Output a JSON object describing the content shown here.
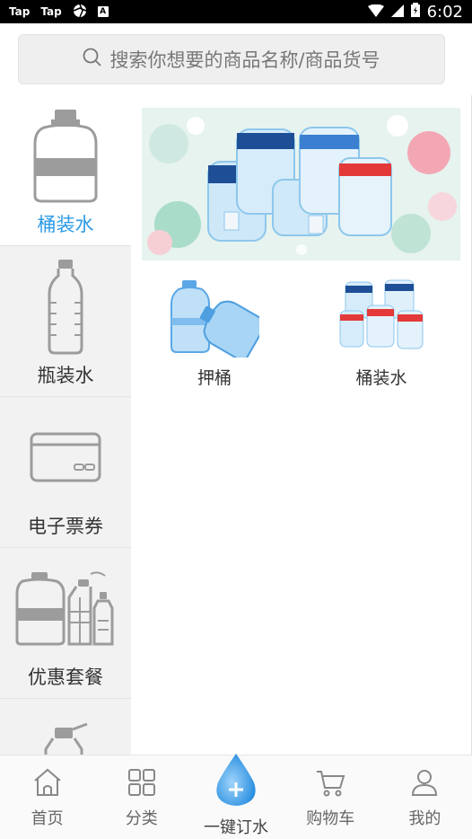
{
  "status_bar": {
    "left_labels": [
      "Tap",
      "Tap"
    ],
    "time": "6:02"
  },
  "search": {
    "placeholder": "搜索你想要的商品名称/商品货号"
  },
  "sidebar": {
    "items": [
      {
        "label": "桶装水",
        "icon": "water-bucket-icon",
        "active": true
      },
      {
        "label": "瓶装水",
        "icon": "water-bottle-icon",
        "active": false
      },
      {
        "label": "电子票券",
        "icon": "ticket-card-icon",
        "active": false
      },
      {
        "label": "优惠套餐",
        "icon": "combo-package-icon",
        "active": false
      },
      {
        "label": "",
        "icon": "spray-bottle-icon",
        "active": false
      }
    ]
  },
  "content": {
    "categories": [
      {
        "name": "押桶",
        "icon": "deposit-bucket-image"
      },
      {
        "name": "桶装水",
        "icon": "bucket-water-image"
      }
    ]
  },
  "tabbar": {
    "tabs": [
      {
        "label": "首页",
        "icon": "home-icon"
      },
      {
        "label": "分类",
        "icon": "grid-icon"
      },
      {
        "label": "一键订水",
        "icon": "water-drop-plus-icon"
      },
      {
        "label": "购物车",
        "icon": "cart-icon"
      },
      {
        "label": "我的",
        "icon": "user-icon"
      }
    ]
  },
  "colors": {
    "accent": "#2b9ae6",
    "sidebar_bg": "#f2f2f2",
    "status_bar": "#000000"
  }
}
